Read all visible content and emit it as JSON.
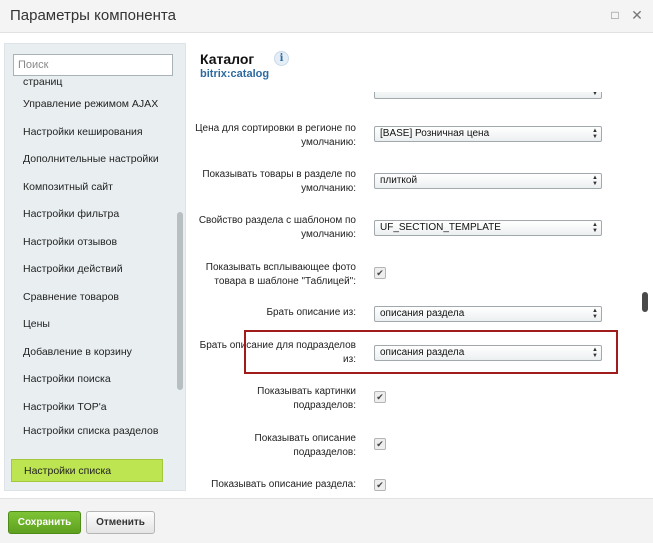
{
  "window": {
    "title": "Параметры компонента"
  },
  "sidebar": {
    "search_placeholder": "Поиск",
    "items": [
      {
        "label": "страниц"
      },
      {
        "label": "Управление режимом AJAX"
      },
      {
        "label": "Настройки кеширования"
      },
      {
        "label": "Дополнительные настройки"
      },
      {
        "label": "Композитный сайт"
      },
      {
        "label": "Настройки фильтра"
      },
      {
        "label": "Настройки отзывов"
      },
      {
        "label": "Настройки действий"
      },
      {
        "label": "Сравнение товаров"
      },
      {
        "label": "Цены"
      },
      {
        "label": "Добавление в корзину"
      },
      {
        "label": "Настройки поиска"
      },
      {
        "label": "Настройки TOP'а"
      },
      {
        "label": "Настройки списка разделов"
      },
      {
        "label": "Настройки списка",
        "active": true
      }
    ]
  },
  "main": {
    "title": "Каталог",
    "subtitle": "bitrix:catalog",
    "rows": [
      {
        "label": "Цена для сортировки в регионе по умолчанию:",
        "type": "select",
        "value": "[BASE] Розничная цена"
      },
      {
        "label": "Показывать товары в разделе по умолчанию:",
        "type": "select",
        "value": "плиткой"
      },
      {
        "label": "Свойство раздела с шаблоном по умолчанию:",
        "type": "select",
        "value": "UF_SECTION_TEMPLATE"
      },
      {
        "label": "Показывать всплывающее фото товара в шаблоне \"Таблицей\":",
        "type": "checkbox",
        "checked": true
      },
      {
        "label": "Брать описание из:",
        "type": "select",
        "value": "описания раздела"
      },
      {
        "label": "Брать описание для подразделов из:",
        "type": "select",
        "value": "описания раздела",
        "highlighted": true
      },
      {
        "label": "Показывать картинки подразделов:",
        "type": "checkbox",
        "checked": true
      },
      {
        "label": "Показывать описание подразделов:",
        "type": "checkbox",
        "checked": true
      },
      {
        "label": "Показывать описание раздела:",
        "type": "checkbox",
        "checked": true
      }
    ]
  },
  "footer": {
    "save_label": "Сохранить",
    "cancel_label": "Отменить"
  },
  "colors": {
    "accent_green": "#7ec436",
    "active_item": "#bde451",
    "link_blue": "#2d6aa0",
    "highlight_red": "#a01c1c"
  }
}
